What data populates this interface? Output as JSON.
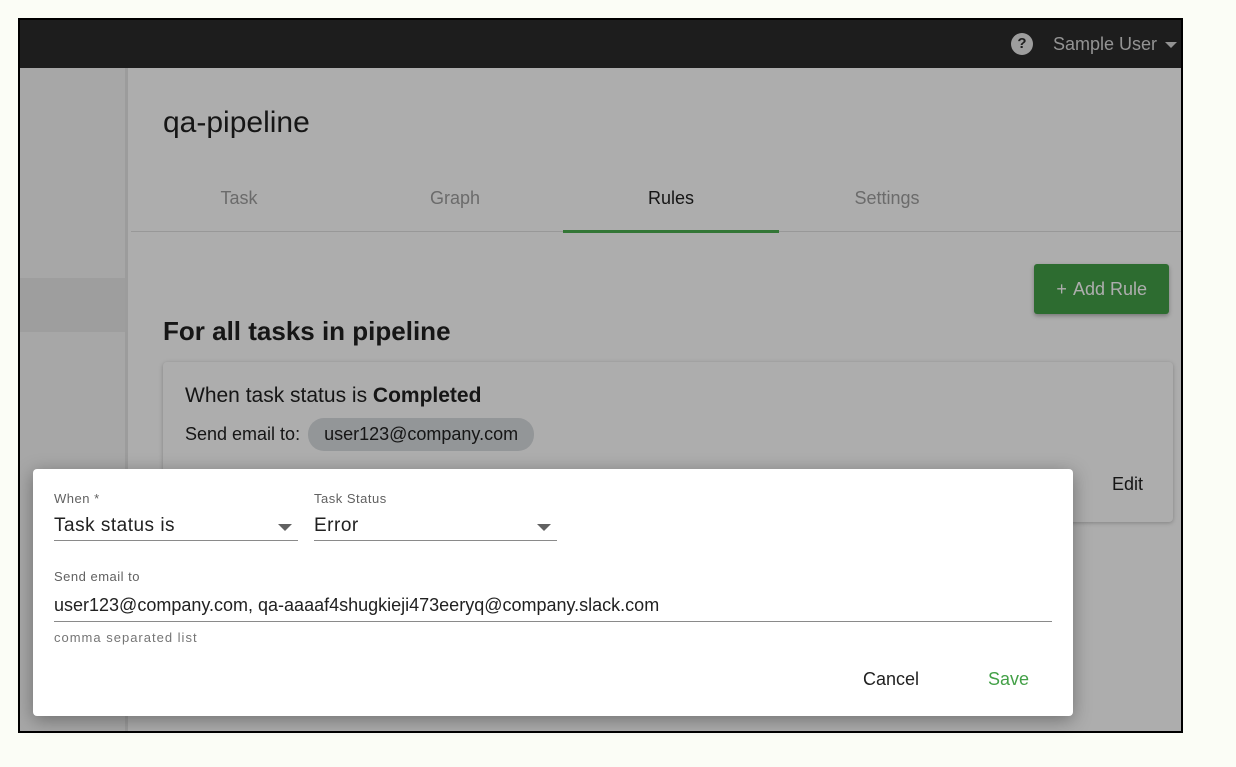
{
  "topbar": {
    "user_name": "Sample User",
    "help_icon": "?"
  },
  "page": {
    "title": "qa-pipeline",
    "tabs": [
      {
        "label": "Task",
        "active": false
      },
      {
        "label": "Graph",
        "active": false
      },
      {
        "label": "Rules",
        "active": true
      },
      {
        "label": "Settings",
        "active": false
      }
    ],
    "add_rule_label": "Add Rule",
    "add_rule_icon": "+",
    "section_title": "For all tasks in pipeline",
    "rule": {
      "condition_prefix": "When task status is",
      "condition_status": "Completed",
      "send_label": "Send email to:",
      "email_chip": "user123@company.com",
      "edit_label": "Edit"
    }
  },
  "dialog": {
    "when_label": "When *",
    "when_value": "Task status is",
    "status_label": "Task Status",
    "status_value": "Error",
    "email_label": "Send email to",
    "email_value": "user123@company.com, qa-aaaaf4shugkieji473eeryq@company.slack.com",
    "helper_text": "comma separated list",
    "cancel_label": "Cancel",
    "save_label": "Save"
  },
  "colors": {
    "topbar": "#2c2c2c",
    "accent": "#43a047",
    "tab_indicator": "#4caf50"
  }
}
